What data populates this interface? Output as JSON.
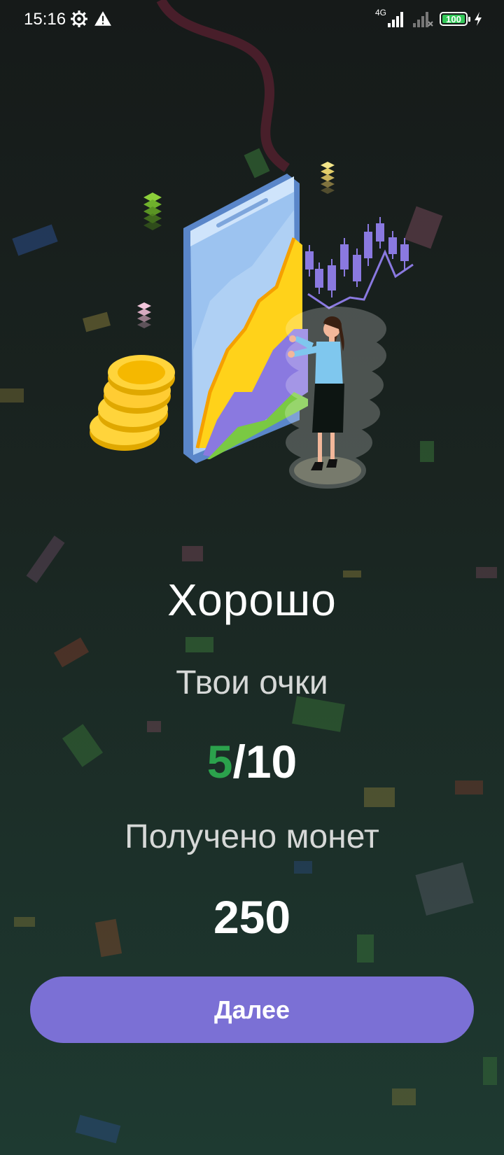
{
  "status_bar": {
    "time": "15:16",
    "network": "4G",
    "battery": "100"
  },
  "result": {
    "title": "Хорошо",
    "score_label": "Твои очки",
    "score_got": "5",
    "score_separator": "/",
    "score_total": "10",
    "coins_label": "Получено монет",
    "coins_value": "250"
  },
  "actions": {
    "next_label": "Далее"
  },
  "colors": {
    "accent": "#7b70d5",
    "score_highlight": "#2ba24c",
    "background": "#1a2521"
  },
  "icons": [
    "gear-icon",
    "warning-icon",
    "signal-icon",
    "battery-icon",
    "charging-icon"
  ]
}
